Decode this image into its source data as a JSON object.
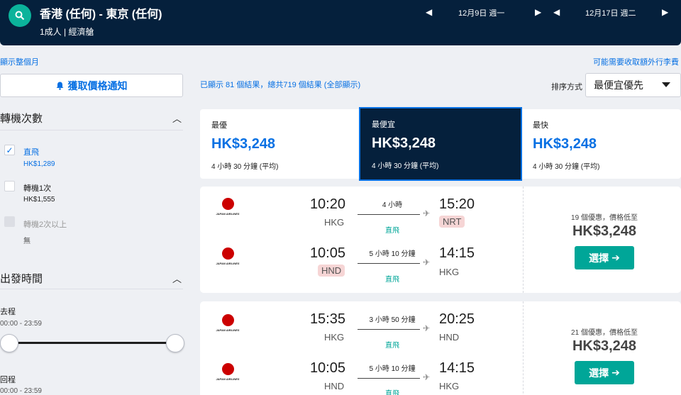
{
  "header": {
    "route": "香港 (任何) - 東京 (任何)",
    "passengers": "1成人 | 經濟艙",
    "depart_date": "12月9日 週一",
    "return_date": "12月17日 週二"
  },
  "links": {
    "show_month": "顯示整個月",
    "baggage_notice": "可能需要收取額外行李費"
  },
  "sidebar": {
    "price_alert": "獲取價格通知",
    "stops": {
      "title": "轉機次數",
      "options": [
        {
          "label": "直飛",
          "price": "HK$1,289",
          "checked": true
        },
        {
          "label": "轉機1次",
          "price": "HK$1,555",
          "checked": false
        },
        {
          "label": "轉機2次以上",
          "price": "無",
          "checked": false
        }
      ]
    },
    "departure_time": {
      "title": "出發時間",
      "outbound_label": "去程",
      "outbound_range": "00:00 - 23:59",
      "return_label": "回程",
      "return_range": "00:00 - 23:59"
    }
  },
  "results": {
    "count_text": "已顯示 81 個結果，總共719 個結果 (全部顯示)",
    "sort_label": "排序方式",
    "sort_value": "最便宜優先"
  },
  "summary_tabs": [
    {
      "title": "最優",
      "price": "HK$3,248",
      "duration": "4 小時 30 分鐘 (平均)"
    },
    {
      "title": "最便宜",
      "price": "HK$3,248",
      "duration": "4 小時 30 分鐘 (平均)"
    },
    {
      "title": "最快",
      "price": "HK$3,248",
      "duration": "4 小時 30 分鐘 (平均)"
    }
  ],
  "cards": [
    {
      "airline_logo_text": "JAPAN AIRLINES",
      "legs": [
        {
          "dep_time": "10:20",
          "dep_code": "HKG",
          "duration": "4 小時",
          "stops": "直飛",
          "arr_time": "15:20",
          "arr_code": "NRT"
        },
        {
          "dep_time": "10:05",
          "dep_code": "HND",
          "duration": "5 小時 10 分鐘",
          "stops": "直飛",
          "arr_time": "14:15",
          "arr_code": "HKG"
        }
      ],
      "deals": "19 個優惠，價格低至",
      "price": "HK$3,248",
      "button": "選擇"
    },
    {
      "airline_logo_text": "JAPAN AIRLINES",
      "legs": [
        {
          "dep_time": "15:35",
          "dep_code": "HKG",
          "duration": "3 小時 50 分鐘",
          "stops": "直飛",
          "arr_time": "20:25",
          "arr_code": "HND"
        },
        {
          "dep_time": "10:05",
          "dep_code": "HND",
          "duration": "5 小時 10 分鐘",
          "stops": "直飛",
          "arr_time": "14:15",
          "arr_code": "HKG"
        }
      ],
      "deals": "21 個優惠，價格低至",
      "price": "HK$3,248",
      "button": "選擇"
    }
  ]
}
